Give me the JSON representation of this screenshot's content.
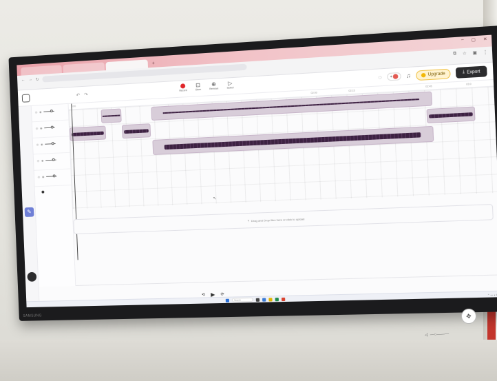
{
  "browser": {
    "tabs": [
      {
        "label": ""
      },
      {
        "label": ""
      },
      {
        "label": ""
      }
    ],
    "new_tab_symbol": "+",
    "window_controls": [
      "–",
      "▢",
      "✕"
    ],
    "url": "",
    "bookmarks_label": ""
  },
  "app": {
    "project_name": "",
    "project_sub": "",
    "undo_symbol": "↶",
    "redo_symbol": "↷",
    "tools": [
      {
        "name": "Record",
        "icon": "record-dot"
      },
      {
        "name": "Stem",
        "icon": "stem-icon",
        "glyph": "⊡"
      },
      {
        "name": "Remove",
        "icon": "remove-icon",
        "glyph": "⊕"
      },
      {
        "name": "Select",
        "icon": "select-icon",
        "glyph": "▷"
      }
    ],
    "upgrade_label": "Upgrade",
    "export_label": "Export",
    "export_icon": "⤓",
    "colors": {
      "accent_record": "#e0262a",
      "clip_fill": "#d8cdd9",
      "wave": "#3d2242",
      "export_bg": "#2c2c2e",
      "upgrade_bg": "#fff3d0"
    }
  },
  "tracks": [
    {
      "name": ""
    },
    {
      "name": ""
    },
    {
      "name": ""
    },
    {
      "name": ""
    },
    {
      "name": ""
    }
  ],
  "new_track_label": "",
  "timeline_ticks": [
    "0:00",
    "",
    "",
    "",
    "",
    "",
    "",
    "",
    "02:00",
    "02:15",
    "",
    "02:45",
    "03:0"
  ],
  "upload_text": "Drag and Drop files here or click to upload",
  "upload_icon": "⤒",
  "transport": {
    "rewind": "⟲",
    "play": "▶",
    "forward": "⟳"
  },
  "taskbar": {
    "search_label": "Search"
  },
  "tv_brand": "SAMSUNG"
}
